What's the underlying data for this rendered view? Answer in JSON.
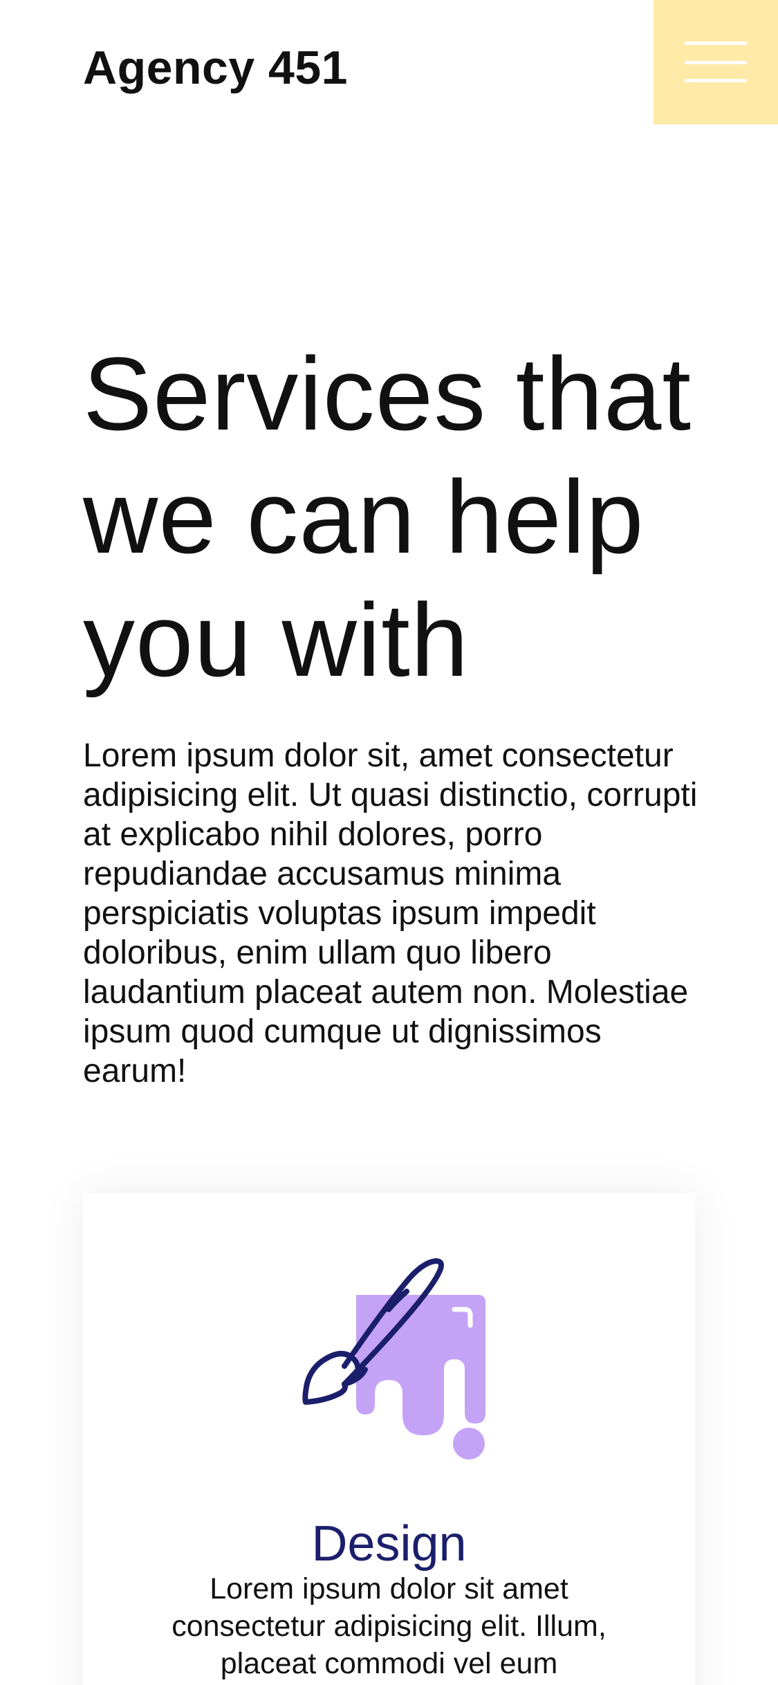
{
  "header": {
    "brand": "Agency 451",
    "menu_icon": "hamburger-menu-icon",
    "menu_bg_color": "#ffeaa7"
  },
  "hero": {
    "title": "Services that we can help you with",
    "text": "Lorem ipsum dolor sit, amet consectetur adipisicing elit. Ut quasi distinctio, corrupti at explicabo nihil dolores, porro repudiandae accusamus minima perspiciatis voluptas ipsum impedit doloribus, enim ullam quo libero laudantium placeat autem non. Molestiae ipsum quod cumque ut dignissimos earum!"
  },
  "services": [
    {
      "icon": "paintbrush-icon",
      "title": "Design",
      "text": "Lorem ipsum dolor sit amet consectetur adipisicing elit. Illum, placeat commodi vel eum"
    }
  ],
  "colors": {
    "accent_yellow": "#ffeaa7",
    "icon_purple": "#c4a3f7",
    "heading_navy": "#1b1f6b"
  }
}
